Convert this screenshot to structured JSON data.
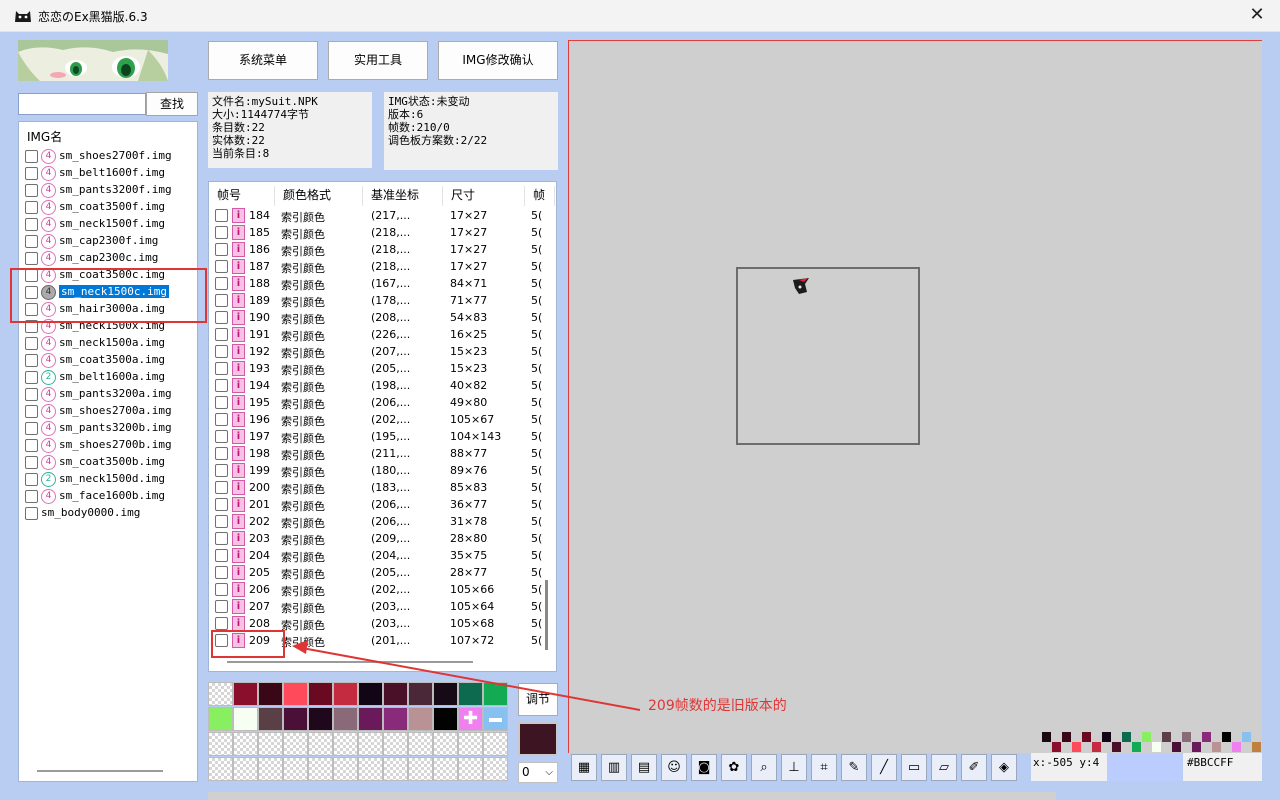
{
  "window": {
    "title": "恋恋のEx黑猫版.6.3",
    "close_glyph": "✕"
  },
  "search": {
    "value": "",
    "button_label": "查找"
  },
  "img_list": {
    "header": "IMG名",
    "items": [
      {
        "name": "sm_shoes2700f.img",
        "badge": "4",
        "color": "pink"
      },
      {
        "name": "sm_belt1600f.img",
        "badge": "4",
        "color": "pink"
      },
      {
        "name": "sm_pants3200f.img",
        "badge": "4",
        "color": "pink"
      },
      {
        "name": "sm_coat3500f.img",
        "badge": "4",
        "color": "pink"
      },
      {
        "name": "sm_neck1500f.img",
        "badge": "4",
        "color": "pink"
      },
      {
        "name": "sm_cap2300f.img",
        "badge": "4",
        "color": "pink"
      },
      {
        "name": "sm_cap2300c.img",
        "badge": "4",
        "color": "pink"
      },
      {
        "name": "sm_coat3500c.img",
        "badge": "4",
        "color": "pink"
      },
      {
        "name": "sm_neck1500c.img",
        "badge": "4",
        "color": "gray",
        "selected": true
      },
      {
        "name": "sm_hair3000a.img",
        "badge": "4",
        "color": "pink"
      },
      {
        "name": "sm_neck1500x.img",
        "badge": "4",
        "color": "pink"
      },
      {
        "name": "sm_neck1500a.img",
        "badge": "4",
        "color": "pink"
      },
      {
        "name": "sm_coat3500a.img",
        "badge": "4",
        "color": "pink"
      },
      {
        "name": "sm_belt1600a.img",
        "badge": "2",
        "color": "teal"
      },
      {
        "name": "sm_pants3200a.img",
        "badge": "4",
        "color": "pink"
      },
      {
        "name": "sm_shoes2700a.img",
        "badge": "4",
        "color": "pink"
      },
      {
        "name": "sm_pants3200b.img",
        "badge": "4",
        "color": "pink"
      },
      {
        "name": "sm_shoes2700b.img",
        "badge": "4",
        "color": "pink"
      },
      {
        "name": "sm_coat3500b.img",
        "badge": "4",
        "color": "pink"
      },
      {
        "name": "sm_neck1500d.img",
        "badge": "2",
        "color": "teal"
      },
      {
        "name": "sm_face1600b.img",
        "badge": "4",
        "color": "pink"
      },
      {
        "name": "sm_body0000.img",
        "badge": "",
        "color": "none"
      }
    ]
  },
  "toolbar_buttons": {
    "system_menu": "系统菜单",
    "tools": "实用工具",
    "img_confirm": "IMG修改确认"
  },
  "file_info": [
    "文件名:mySuit.NPK",
    "大小:1144774字节",
    "条目数:22",
    "实体数:22",
    "当前条目:8"
  ],
  "img_info": [
    "IMG状态:未变动",
    "版本:6",
    "帧数:210/0",
    "调色板方案数:2/22"
  ],
  "frame_table": {
    "columns": [
      "帧号",
      "颜色格式",
      "基准坐标",
      "尺寸",
      "帧"
    ],
    "rows": [
      {
        "no": "184",
        "fmt": "索引颜色",
        "pos": "(217,...",
        "size": "17×27",
        "extra": "5("
      },
      {
        "no": "185",
        "fmt": "索引颜色",
        "pos": "(218,...",
        "size": "17×27",
        "extra": "5("
      },
      {
        "no": "186",
        "fmt": "索引颜色",
        "pos": "(218,...",
        "size": "17×27",
        "extra": "5("
      },
      {
        "no": "187",
        "fmt": "索引颜色",
        "pos": "(218,...",
        "size": "17×27",
        "extra": "5("
      },
      {
        "no": "188",
        "fmt": "索引颜色",
        "pos": "(167,...",
        "size": "84×71",
        "extra": "5("
      },
      {
        "no": "189",
        "fmt": "索引颜色",
        "pos": "(178,...",
        "size": "71×77",
        "extra": "5("
      },
      {
        "no": "190",
        "fmt": "索引颜色",
        "pos": "(208,...",
        "size": "54×83",
        "extra": "5("
      },
      {
        "no": "191",
        "fmt": "索引颜色",
        "pos": "(226,...",
        "size": "16×25",
        "extra": "5("
      },
      {
        "no": "192",
        "fmt": "索引颜色",
        "pos": "(207,...",
        "size": "15×23",
        "extra": "5("
      },
      {
        "no": "193",
        "fmt": "索引颜色",
        "pos": "(205,...",
        "size": "15×23",
        "extra": "5("
      },
      {
        "no": "194",
        "fmt": "索引颜色",
        "pos": "(198,...",
        "size": "40×82",
        "extra": "5("
      },
      {
        "no": "195",
        "fmt": "索引颜色",
        "pos": "(206,...",
        "size": "49×80",
        "extra": "5("
      },
      {
        "no": "196",
        "fmt": "索引颜色",
        "pos": "(202,...",
        "size": "105×67",
        "extra": "5("
      },
      {
        "no": "197",
        "fmt": "索引颜色",
        "pos": "(195,...",
        "size": "104×143",
        "extra": "5("
      },
      {
        "no": "198",
        "fmt": "索引颜色",
        "pos": "(211,...",
        "size": "88×77",
        "extra": "5("
      },
      {
        "no": "199",
        "fmt": "索引颜色",
        "pos": "(180,...",
        "size": "89×76",
        "extra": "5("
      },
      {
        "no": "200",
        "fmt": "索引颜色",
        "pos": "(183,...",
        "size": "85×83",
        "extra": "5("
      },
      {
        "no": "201",
        "fmt": "索引颜色",
        "pos": "(206,...",
        "size": "36×77",
        "extra": "5("
      },
      {
        "no": "202",
        "fmt": "索引颜色",
        "pos": "(206,...",
        "size": "31×78",
        "extra": "5("
      },
      {
        "no": "203",
        "fmt": "索引颜色",
        "pos": "(209,...",
        "size": "28×80",
        "extra": "5("
      },
      {
        "no": "204",
        "fmt": "索引颜色",
        "pos": "(204,...",
        "size": "35×75",
        "extra": "5("
      },
      {
        "no": "205",
        "fmt": "索引颜色",
        "pos": "(205,...",
        "size": "28×77",
        "extra": "5("
      },
      {
        "no": "206",
        "fmt": "索引颜色",
        "pos": "(202,...",
        "size": "105×66",
        "extra": "5("
      },
      {
        "no": "207",
        "fmt": "索引颜色",
        "pos": "(203,...",
        "size": "105×64",
        "extra": "5("
      },
      {
        "no": "208",
        "fmt": "索引颜色",
        "pos": "(203,...",
        "size": "105×68",
        "extra": "5("
      },
      {
        "no": "209",
        "fmt": "索引颜色",
        "pos": "(201,...",
        "size": "107×72",
        "extra": "5("
      }
    ]
  },
  "palette": {
    "colors": [
      "checker",
      "#8a0f2c",
      "#3a0716",
      "#ff4a5c",
      "#6a0a22",
      "#c42a40",
      "#120616",
      "#4a1028",
      "#4a2838",
      "#150a16",
      "#0d6a4e",
      "#12aa52",
      "#88f060",
      "#f6fff2",
      "#5a4046",
      "#4a1038",
      "#20081c",
      "#8a6a78",
      "#6a1a5a",
      "#8a2a7a",
      "#b89294",
      "#020203",
      "#f080f0",
      "#88c0f0"
    ],
    "adjust_label": "调节",
    "index_value": "0",
    "index_arrow": "⌵"
  },
  "tools": [
    {
      "icon": "frame-list-icon",
      "glyph": "▦"
    },
    {
      "icon": "layers-icon",
      "glyph": "▥"
    },
    {
      "icon": "film-icon",
      "glyph": "▤"
    },
    {
      "icon": "cat-icon",
      "glyph": "☺"
    },
    {
      "icon": "camera-icon",
      "glyph": "◙"
    },
    {
      "icon": "paw-icon",
      "glyph": "✿"
    },
    {
      "icon": "magnifier-icon",
      "glyph": "⌕"
    },
    {
      "icon": "axis-icon",
      "glyph": "⊥"
    },
    {
      "icon": "crop-icon",
      "glyph": "⌗"
    },
    {
      "icon": "pencil-icon",
      "glyph": "✎"
    },
    {
      "icon": "line-icon",
      "glyph": "╱"
    },
    {
      "icon": "rectangle-icon",
      "glyph": "▭"
    },
    {
      "icon": "eraser-icon",
      "glyph": "▱"
    },
    {
      "icon": "eyedropper-icon",
      "glyph": "✐"
    },
    {
      "icon": "tag-icon",
      "glyph": "◈"
    }
  ],
  "status": {
    "coords": "x:-505 y:4",
    "hex": "#BBCCFF"
  },
  "annotation": {
    "text": "209帧数的是旧版本的"
  }
}
